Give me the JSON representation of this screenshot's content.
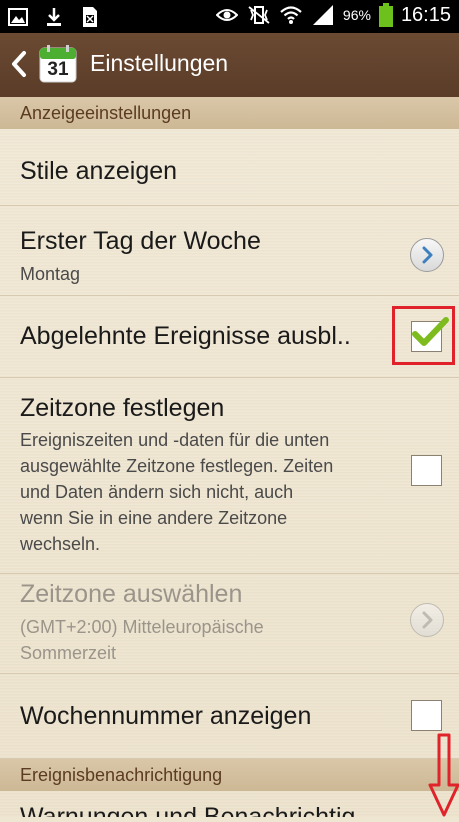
{
  "status_bar": {
    "left_icons": [
      "image-icon",
      "download-icon",
      "sim-card-icon"
    ],
    "right_icons": [
      "eye-icon",
      "vibrate-icon",
      "wifi-icon",
      "signal-icon",
      "battery-icon"
    ],
    "battery_percent": "96%",
    "time": "16:15"
  },
  "action_bar": {
    "back_icon": "chevron-left-icon",
    "app_icon_text": "31",
    "title": "Einstellungen"
  },
  "sections": {
    "display": "Anzeigeeinstellungen",
    "notifications": "Ereignisbenachrichtigung"
  },
  "settings": [
    {
      "title": "Stile anzeigen"
    },
    {
      "title": "Erster Tag der Woche",
      "subtitle": "Montag",
      "control": "chevron"
    },
    {
      "title": "Abgelehnte Ereignisse ausbl..",
      "control": "checkbox",
      "checked": true
    },
    {
      "title": "Zeitzone festlegen",
      "subtitle_lines": [
        "Ereigniszeiten und -daten für die unten",
        "ausgewählte Zeitzone festlegen. Zeiten",
        "und Daten ändern sich nicht, auch",
        "wenn Sie in eine andere Zeitzone",
        "wechseln."
      ],
      "control": "checkbox",
      "checked": false
    },
    {
      "title": "Zeitzone auswählen",
      "subtitle_lines": [
        "(GMT+2:00) Mitteleuropäische",
        "Sommerzeit"
      ],
      "control": "chevron",
      "enabled": false
    },
    {
      "title": "Wochennummer anzeigen",
      "control": "checkbox",
      "checked": false
    },
    {
      "title": "Warnungen und Benachrichtig"
    }
  ],
  "colors": {
    "action_bar": "#5a3c28",
    "check_green": "#7dbb1e",
    "annotation_red": "#e0232b"
  }
}
